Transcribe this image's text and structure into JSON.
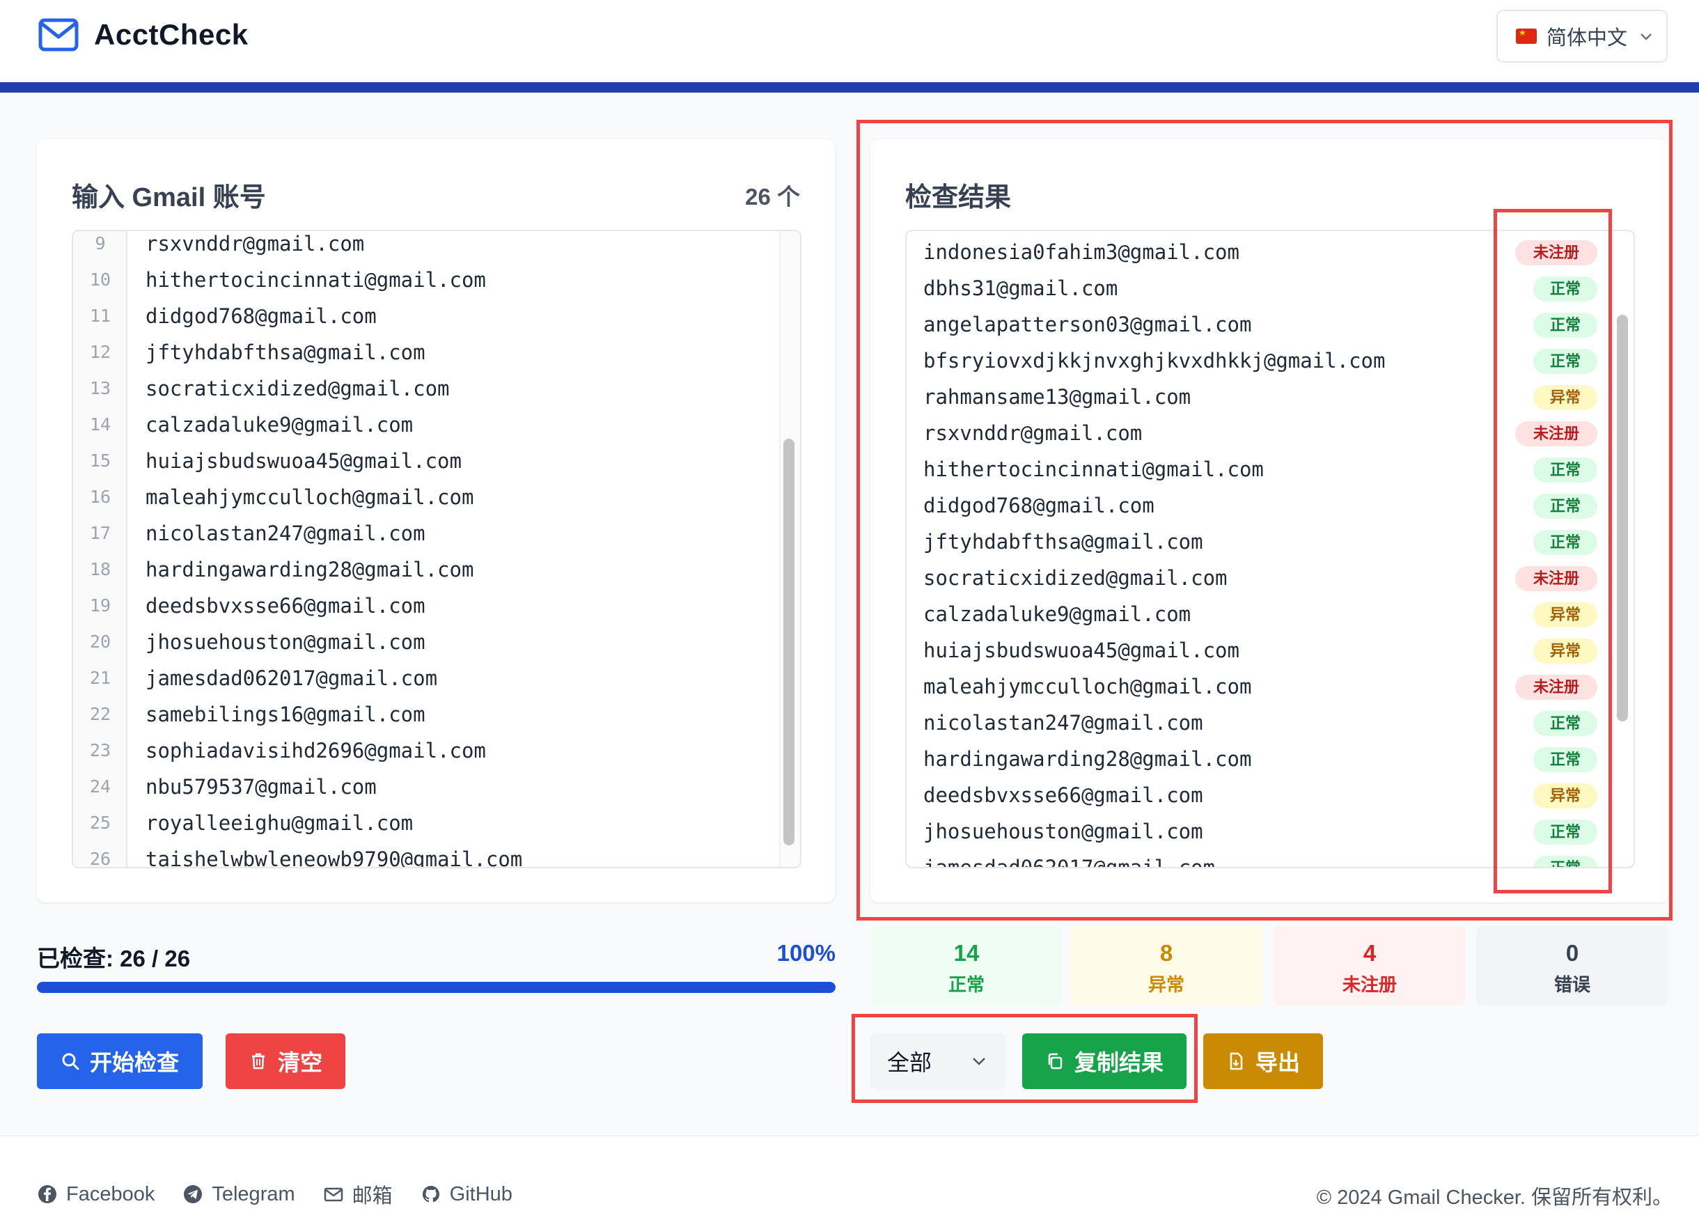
{
  "app": {
    "name": "AcctCheck",
    "language": "简体中文"
  },
  "input_panel": {
    "title": "输入 Gmail 账号",
    "count": "26 个",
    "lines": [
      {
        "n": "9",
        "text": "rsxvnddr@gmail.com"
      },
      {
        "n": "10",
        "text": "hithertocincinnati@gmail.com"
      },
      {
        "n": "11",
        "text": "didgod768@gmail.com"
      },
      {
        "n": "12",
        "text": "jftyhdabfthsa@gmail.com"
      },
      {
        "n": "13",
        "text": "socraticxidized@gmail.com"
      },
      {
        "n": "14",
        "text": "calzadaluke9@gmail.com"
      },
      {
        "n": "15",
        "text": "huiajsbudswuoa45@gmail.com"
      },
      {
        "n": "16",
        "text": "maleahjymcculloch@gmail.com"
      },
      {
        "n": "17",
        "text": "nicolastan247@gmail.com"
      },
      {
        "n": "18",
        "text": "hardingawarding28@gmail.com"
      },
      {
        "n": "19",
        "text": "deedsbvxsse66@gmail.com"
      },
      {
        "n": "20",
        "text": "jhosuehouston@gmail.com"
      },
      {
        "n": "21",
        "text": "jamesdad062017@gmail.com"
      },
      {
        "n": "22",
        "text": "samebilings16@gmail.com"
      },
      {
        "n": "23",
        "text": "sophiadavisihd2696@gmail.com"
      },
      {
        "n": "24",
        "text": "nbu579537@gmail.com"
      },
      {
        "n": "25",
        "text": "royalleeighu@gmail.com"
      },
      {
        "n": "26",
        "text": "taishelwbwleneowb9790@gmail.com"
      }
    ]
  },
  "results_panel": {
    "title": "检查结果",
    "rows": [
      {
        "email": "indonesia0fahim3@gmail.com",
        "status": "未注册",
        "kind": "un"
      },
      {
        "email": "dbhs31@gmail.com",
        "status": "正常",
        "kind": "ok"
      },
      {
        "email": "angelapatterson03@gmail.com",
        "status": "正常",
        "kind": "ok"
      },
      {
        "email": "bfsryiovxdjkkjnvxghjkvxdhkkj@gmail.com",
        "status": "正常",
        "kind": "ok"
      },
      {
        "email": "rahmansame13@gmail.com",
        "status": "异常",
        "kind": "ab"
      },
      {
        "email": "rsxvnddr@gmail.com",
        "status": "未注册",
        "kind": "un"
      },
      {
        "email": "hithertocincinnati@gmail.com",
        "status": "正常",
        "kind": "ok"
      },
      {
        "email": "didgod768@gmail.com",
        "status": "正常",
        "kind": "ok"
      },
      {
        "email": "jftyhdabfthsa@gmail.com",
        "status": "正常",
        "kind": "ok"
      },
      {
        "email": "socraticxidized@gmail.com",
        "status": "未注册",
        "kind": "un"
      },
      {
        "email": "calzadaluke9@gmail.com",
        "status": "异常",
        "kind": "ab"
      },
      {
        "email": "huiajsbudswuoa45@gmail.com",
        "status": "异常",
        "kind": "ab"
      },
      {
        "email": "maleahjymcculloch@gmail.com",
        "status": "未注册",
        "kind": "un"
      },
      {
        "email": "nicolastan247@gmail.com",
        "status": "正常",
        "kind": "ok"
      },
      {
        "email": "hardingawarding28@gmail.com",
        "status": "正常",
        "kind": "ok"
      },
      {
        "email": "deedsbvxsse66@gmail.com",
        "status": "异常",
        "kind": "ab"
      },
      {
        "email": "jhosuehouston@gmail.com",
        "status": "正常",
        "kind": "ok"
      },
      {
        "email": "jamesdad062017@gmail.com",
        "status": "正常",
        "kind": "ok"
      }
    ]
  },
  "progress": {
    "label": "已检查: 26 / 26",
    "percent_text": "100%",
    "fraction": 1.0
  },
  "stats": {
    "ok": {
      "value": "14",
      "label": "正常"
    },
    "abnormal": {
      "value": "8",
      "label": "异常"
    },
    "unregistered": {
      "value": "4",
      "label": "未注册"
    },
    "error": {
      "value": "0",
      "label": "错误"
    }
  },
  "actions": {
    "start": "开始检查",
    "clear": "清空",
    "filter": "全部",
    "copy": "复制结果",
    "export": "导出"
  },
  "footer": {
    "facebook": "Facebook",
    "telegram": "Telegram",
    "email": "邮箱",
    "github": "GitHub",
    "copyright": "© 2024 Gmail Checker. 保留所有权利。"
  },
  "colors": {
    "primary": "#2563eb",
    "danger": "#ef4444",
    "success": "#16a34a",
    "warning": "#ca8a04",
    "highlight": "#ef4444"
  }
}
